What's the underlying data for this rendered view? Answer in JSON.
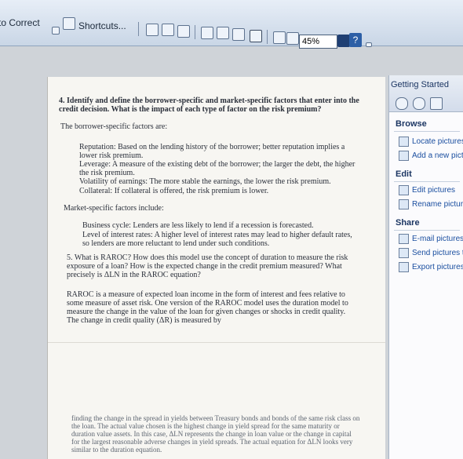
{
  "toolbar": {
    "left_label": "to Correct",
    "shortcuts_label": "Shortcuts...",
    "zoom_value": "45%",
    "help_label": "?"
  },
  "document": {
    "q4_title": "4. Identify and define the borrower-specific and market-specific factors that enter into the credit decision. What is the impact of each type of factor on the risk premium?",
    "borrower_header": "The borrower-specific factors are:",
    "reputation": "Reputation:   Based on the lending history of the borrower; better reputation implies a lower risk premium.",
    "leverage": "Leverage:   A measure of the existing debt of the borrower; the larger the debt, the higher the risk premium.",
    "volatility": "Volatility of earnings:   The more stable the earnings, the lower the risk premium.",
    "collateral": "Collateral:   If collateral is offered, the risk premium is lower.",
    "market_header": "Market-specific factors include:",
    "business_cycle": "Business cycle:   Lenders are less likely to lend if a recession is forecasted.",
    "interest_rates": "Level of interest rates:   A higher level of interest rates may lead to higher default rates, so lenders are more reluctant to lend under such conditions.",
    "q5_title": "5. What is RAROC? How does this model use the concept of duration to measure the risk exposure of a loan? How is the expected change in the credit premium measured? What precisely is ΔLN in the RAROC equation?",
    "raroc_para": "RAROC is a measure of expected loan income in the form of interest and fees relative to some measure of asset risk. One version of the RAROC model uses the duration model to measure the change in the value of the loan for given changes or shocks in credit quality. The change in credit quality (ΔR) is measured by",
    "bottom_para": "finding the change in the spread in yields between Treasury bonds and bonds of the same risk class on the loan. The actual value chosen is the highest change in yield spread for the same maturity or duration value assets. In this case, ΔLN represents the change in loan value or the change in capital for the largest reasonable adverse changes in yield spreads. The actual equation for ΔLN looks very similar to the duration equation."
  },
  "pane": {
    "title": "Getting Started",
    "browse_header": "Browse",
    "locate": "Locate pictures",
    "add_new": "Add a new pict",
    "edit_header": "Edit",
    "edit_pictures": "Edit pictures",
    "rename": "Rename picture",
    "share_header": "Share",
    "email": "E-mail pictures",
    "send": "Send pictures to",
    "export": "Export pictures"
  }
}
